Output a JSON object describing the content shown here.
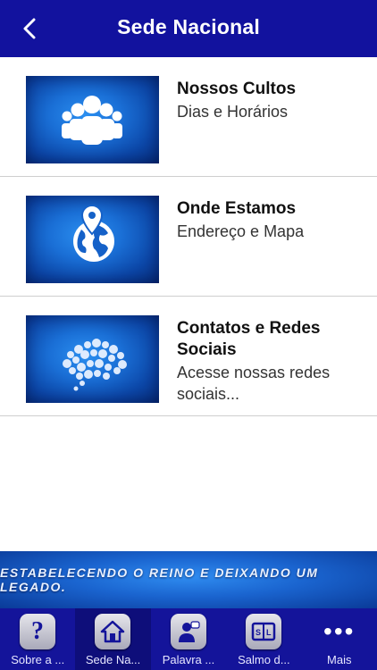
{
  "header": {
    "title": "Sede Nacional"
  },
  "items": [
    {
      "title": "Nossos Cultos",
      "subtitle": "Dias e Horários",
      "icon": "people-group-icon"
    },
    {
      "title": "Onde Estamos",
      "subtitle": "Endereço e Mapa",
      "icon": "globe-location-icon"
    },
    {
      "title": "Contatos e Redes Sociais",
      "subtitle": "Acesse nossas redes sociais...",
      "icon": "social-media-cloud-icon"
    }
  ],
  "banner": {
    "text": "ESTABELECENDO O REINO E DEIXANDO UM LEGADO."
  },
  "tabs": [
    {
      "label": "Sobre a ...",
      "icon": "question-icon",
      "active": false
    },
    {
      "label": "Sede Na...",
      "icon": "house-icon",
      "active": true
    },
    {
      "label": "Palavra ...",
      "icon": "preacher-icon",
      "active": false
    },
    {
      "label": "Salmo d...",
      "icon": "book-icon",
      "active": false
    },
    {
      "label": "Mais",
      "icon": "more-icon",
      "active": false
    }
  ],
  "colors": {
    "nav_bg": "#12129e",
    "tab_bg": "#14149a",
    "accent_blue": "#1a6fd6"
  }
}
